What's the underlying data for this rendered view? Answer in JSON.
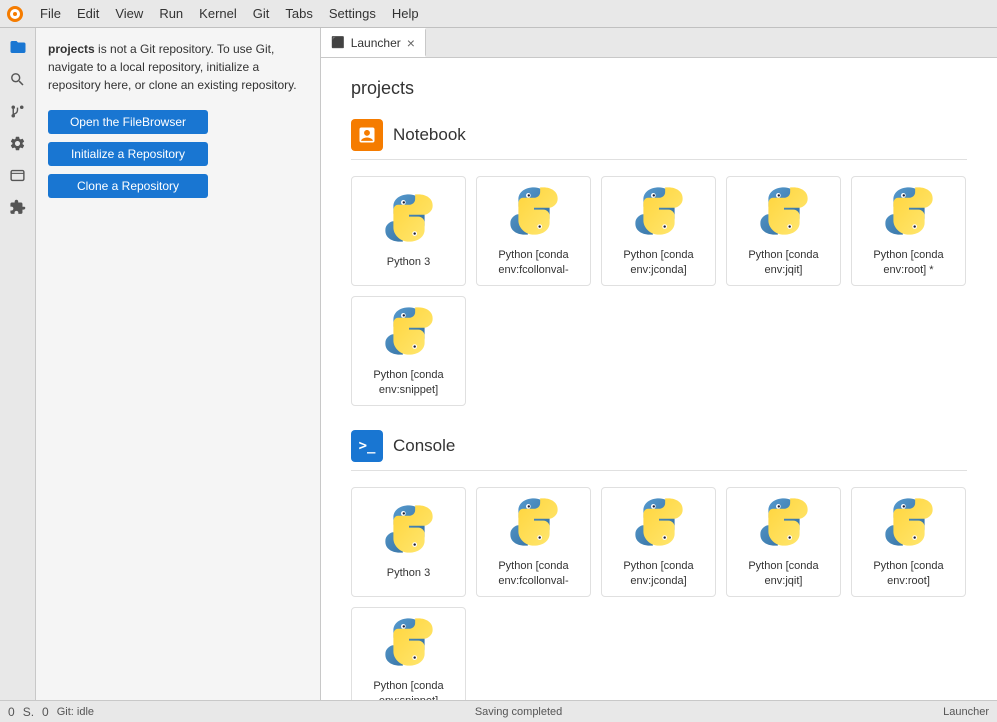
{
  "menubar": {
    "items": [
      "File",
      "Edit",
      "View",
      "Run",
      "Kernel",
      "Git",
      "Tabs",
      "Settings",
      "Help"
    ]
  },
  "activity_bar": {
    "icons": [
      {
        "name": "folder-icon",
        "symbol": "📁",
        "active": true
      },
      {
        "name": "search-icon",
        "symbol": "🔍",
        "active": false
      },
      {
        "name": "git-icon",
        "symbol": "🔷",
        "active": false
      },
      {
        "name": "debug-icon",
        "symbol": "🔧",
        "active": false
      },
      {
        "name": "extensions-icon",
        "symbol": "🧩",
        "active": false
      }
    ]
  },
  "git_panel": {
    "message_part1": "projects",
    "message_part2": " is not a Git repository. To use Git, navigate to a local repository, initialize a repository here, or clone an existing repository.",
    "buttons": [
      {
        "label": "Open the FileBrowser",
        "name": "open-filebrowser-button"
      },
      {
        "label": "Initialize a Repository",
        "name": "initialize-repo-button"
      },
      {
        "label": "Clone a Repository",
        "name": "clone-repo-button"
      }
    ]
  },
  "tabs": [
    {
      "label": "Launcher",
      "icon": "⬛",
      "active": true,
      "closable": true
    }
  ],
  "launcher": {
    "title": "projects",
    "sections": [
      {
        "id": "notebook",
        "title": "Notebook",
        "icon_type": "notebook",
        "kernels": [
          {
            "name": "Python 3",
            "id": "python3"
          },
          {
            "name": "Python [conda\nenv:fcollonval-",
            "id": "conda-fcollonval"
          },
          {
            "name": "Python [conda\nenv:jconda]",
            "id": "conda-jconda"
          },
          {
            "name": "Python [conda\nenv:jqit]",
            "id": "conda-jqit"
          },
          {
            "name": "Python [conda\nenv:root] *",
            "id": "conda-root"
          },
          {
            "name": "Python [conda\nenv:snippet]",
            "id": "conda-snippet"
          }
        ]
      },
      {
        "id": "console",
        "title": "Console",
        "icon_type": "console",
        "kernels": [
          {
            "name": "Python 3",
            "id": "console-python3"
          },
          {
            "name": "Python [conda\nenv:fcollonval-",
            "id": "console-conda-fcollonval"
          },
          {
            "name": "Python [conda\nenv:jconda]",
            "id": "console-conda-jconda"
          },
          {
            "name": "Python [conda\nenv:jqit]",
            "id": "console-conda-jqit"
          },
          {
            "name": "Python [conda\nenv:root]",
            "id": "console-conda-root"
          },
          {
            "name": "Python [conda\nenv:snippet]",
            "id": "console-conda-snippet"
          }
        ]
      }
    ]
  },
  "status_bar": {
    "left_items": [
      "0",
      "S.",
      "0"
    ],
    "git_status": "Git: idle",
    "center_message": "Saving completed",
    "right_label": "Launcher"
  }
}
